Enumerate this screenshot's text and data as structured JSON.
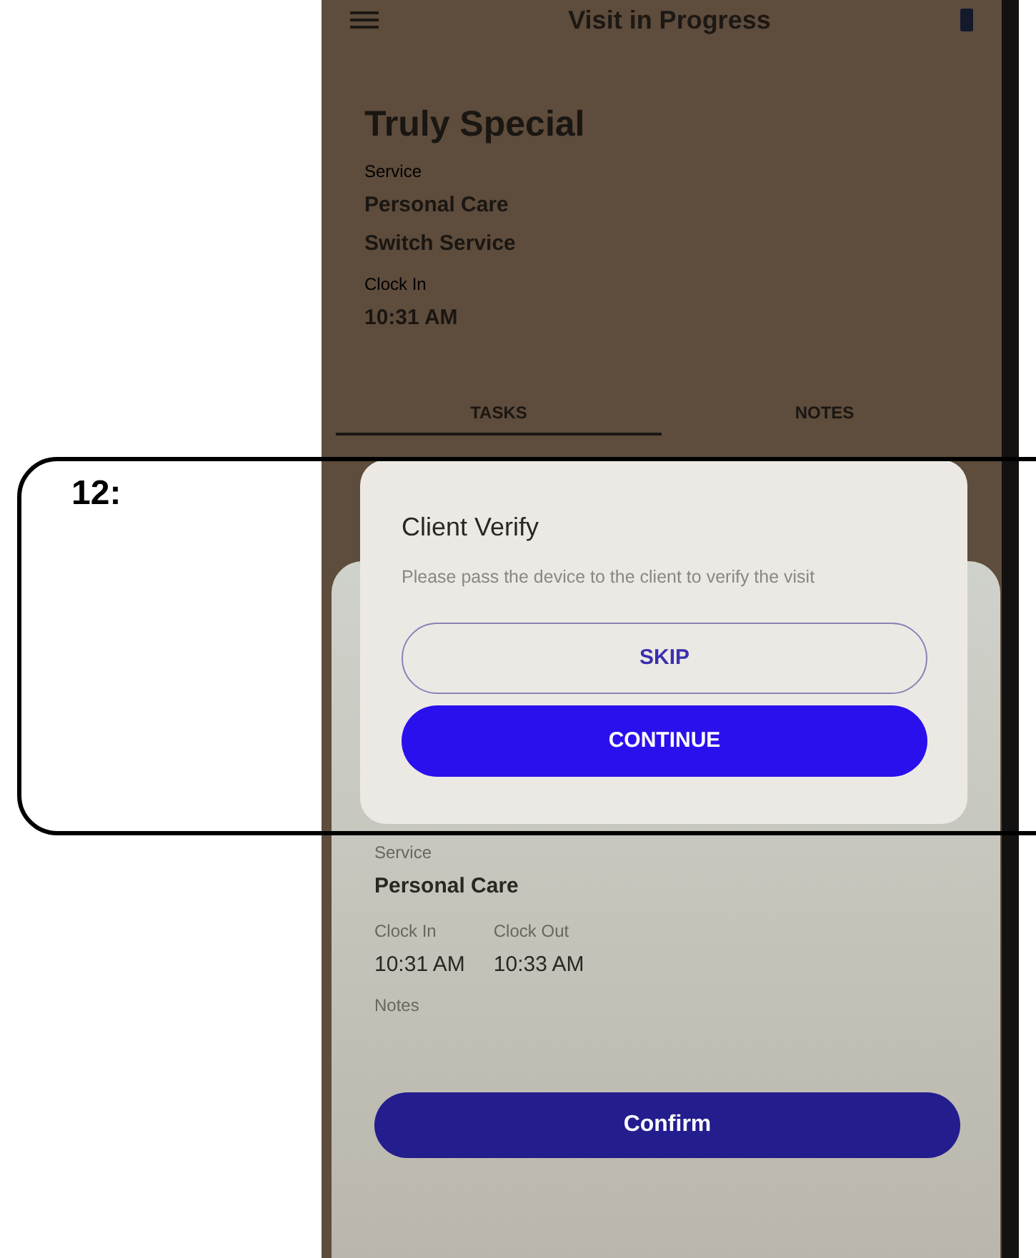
{
  "annotation": {
    "label": "12:"
  },
  "app_bar": {
    "title": "Visit in Progress"
  },
  "client": {
    "name": "Truly Special",
    "fields": [
      {
        "label": "Service",
        "values": [
          "Personal Care",
          "Switch Service"
        ]
      },
      {
        "label": "Clock In",
        "values": [
          "10:31 AM"
        ]
      }
    ]
  },
  "tabs": [
    {
      "label": "TASKS",
      "selected": true
    },
    {
      "label": "NOTES",
      "selected": false
    }
  ],
  "dialog": {
    "title": "Client Verify",
    "message": "Please pass the device to the client to verify the visit",
    "buttons": [
      {
        "label": "SKIP",
        "kind": "outline"
      },
      {
        "label": "CONTINUE",
        "kind": "filled"
      }
    ]
  },
  "summary_sheet": {
    "service_label": "Service",
    "service": "Personal Care",
    "times": [
      {
        "label": "Clock In",
        "value": "10:31 AM"
      },
      {
        "label": "Clock Out",
        "value": "10:33 AM"
      }
    ],
    "notes_label": "Notes",
    "confirm_button": "Confirm"
  }
}
